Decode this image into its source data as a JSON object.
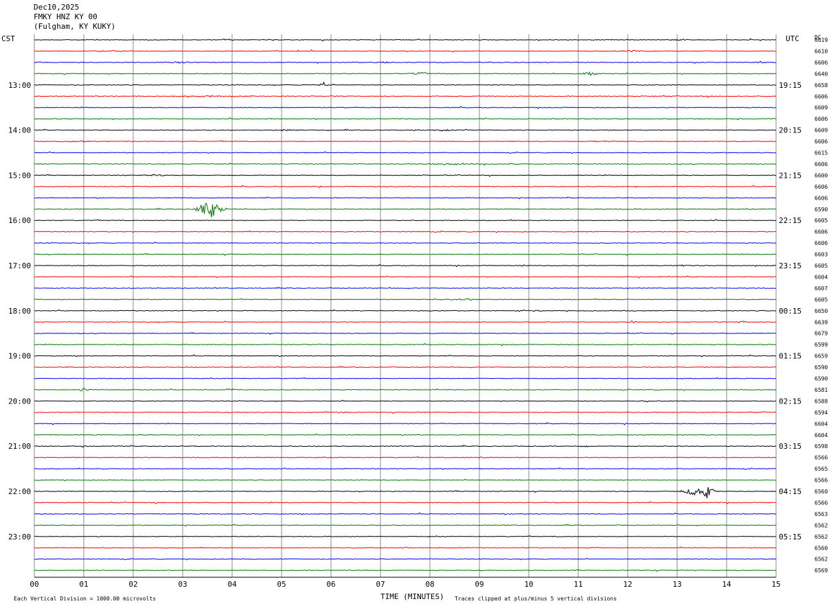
{
  "header": {
    "date": "Dec10,2025",
    "station": "FMKY HNZ KY 00",
    "location": "(Fulgham, KY KUKY)"
  },
  "labels": {
    "left_tz": "CST",
    "right_tz": "UTC",
    "dc_label": "DC",
    "xlabel": "TIME (MINUTES)",
    "scale_note": "Each Vertical Division = 1000.00 microvolts",
    "clip_note": "Traces clipped at plus/minus 5 vertical divisions"
  },
  "colors": {
    "cycle": [
      "#000000",
      "#ff0000",
      "#0000ff",
      "#007700"
    ],
    "grid": "#888888"
  },
  "chart_data": {
    "type": "line",
    "title": "",
    "xlabel": "TIME (MINUTES)",
    "ylabel": "",
    "xlim": [
      0,
      15
    ],
    "x_ticks": [
      "00",
      "01",
      "02",
      "03",
      "04",
      "05",
      "06",
      "07",
      "08",
      "09",
      "10",
      "11",
      "12",
      "13",
      "14",
      "15"
    ],
    "left_hour_labels": [
      "13:00",
      "14:00",
      "15:00",
      "16:00",
      "17:00",
      "18:00",
      "19:00",
      "20:00",
      "21:00",
      "22:00",
      "23:00"
    ],
    "right_hour_labels": [
      "19:15",
      "20:15",
      "21:15",
      "22:15",
      "23:15",
      "00:15",
      "01:15",
      "02:15",
      "03:15",
      "04:15",
      "05:15"
    ],
    "lines_per_hour": 4,
    "first_label_line": 4,
    "dc_values": [
      "6619",
      "6610",
      "6606",
      "6640",
      "6658",
      "6606",
      "6609",
      "6606",
      "6609",
      "6606",
      "6615",
      "6606",
      "6600",
      "6606",
      "6606",
      "6590",
      "6605",
      "6606",
      "6606",
      "6603",
      "6605",
      "6604",
      "6607",
      "6605",
      "6650",
      "6639",
      "6679",
      "6599",
      "6659",
      "6590",
      "6590",
      "6581",
      "6588",
      "6594",
      "6604",
      "6604",
      "6598",
      "6566",
      "6565",
      "6566",
      "6560",
      "6566",
      "6563",
      "6562",
      "6562",
      "6560",
      "6562",
      "6569"
    ],
    "events": [
      {
        "line": 0,
        "t": 3.95,
        "amp": 1.2,
        "dur": 0.3
      },
      {
        "line": 0,
        "t": 13.1,
        "amp": 1.5,
        "dur": 0.4
      },
      {
        "line": 1,
        "t": 1.5,
        "amp": 1.0,
        "dur": 0.9
      },
      {
        "line": 1,
        "t": 12.0,
        "amp": 1.2,
        "dur": 1.2
      },
      {
        "line": 2,
        "t": 2.9,
        "amp": 1.2,
        "dur": 0.4
      },
      {
        "line": 2,
        "t": 7.1,
        "amp": 1.0,
        "dur": 0.5
      },
      {
        "line": 2,
        "t": 14.7,
        "amp": 2.0,
        "dur": 0.2
      },
      {
        "line": 3,
        "t": 7.8,
        "amp": 2.8,
        "dur": 0.4
      },
      {
        "line": 3,
        "t": 11.2,
        "amp": 3.0,
        "dur": 0.4
      },
      {
        "line": 4,
        "t": 5.85,
        "amp": 4.0,
        "dur": 0.15
      },
      {
        "line": 5,
        "t": 3.5,
        "amp": 1.0,
        "dur": 2.0
      },
      {
        "line": 8,
        "t": 5.1,
        "amp": 1.2,
        "dur": 0.6
      },
      {
        "line": 8,
        "t": 8.2,
        "amp": 1.2,
        "dur": 1.0
      },
      {
        "line": 9,
        "t": 1.0,
        "amp": 1.2,
        "dur": 0.8
      },
      {
        "line": 9,
        "t": 11.6,
        "amp": 1.0,
        "dur": 1.0
      },
      {
        "line": 11,
        "t": 8.5,
        "amp": 1.0,
        "dur": 3.5
      },
      {
        "line": 12,
        "t": 2.5,
        "amp": 1.0,
        "dur": 0.8
      },
      {
        "line": 15,
        "t": 3.55,
        "amp": 14.0,
        "dur": 0.5
      },
      {
        "line": 20,
        "t": 9.9,
        "amp": 1.5,
        "dur": 0.15
      },
      {
        "line": 20,
        "t": 13.1,
        "amp": 1.5,
        "dur": 0.2
      },
      {
        "line": 23,
        "t": 8.6,
        "amp": 1.2,
        "dur": 1.2
      },
      {
        "line": 24,
        "t": 10.1,
        "amp": 1.0,
        "dur": 0.3
      },
      {
        "line": 25,
        "t": 12.1,
        "amp": 2.0,
        "dur": 0.3
      },
      {
        "line": 25,
        "t": 14.3,
        "amp": 1.5,
        "dur": 0.2
      },
      {
        "line": 31,
        "t": 1.0,
        "amp": 3.0,
        "dur": 0.2
      },
      {
        "line": 31,
        "t": 3.95,
        "amp": 3.0,
        "dur": 0.2
      },
      {
        "line": 32,
        "t": 12.4,
        "amp": 2.0,
        "dur": 0.15
      },
      {
        "line": 33,
        "t": 6.2,
        "amp": 2.0,
        "dur": 0.25
      },
      {
        "line": 36,
        "t": 11.1,
        "amp": 1.0,
        "dur": 0.2
      },
      {
        "line": 37,
        "t": 9.0,
        "amp": 1.0,
        "dur": 0.2
      },
      {
        "line": 40,
        "t": 13.35,
        "amp": 6.0,
        "dur": 0.5
      },
      {
        "line": 40,
        "t": 13.6,
        "amp": 10.0,
        "dur": 0.3
      }
    ]
  }
}
